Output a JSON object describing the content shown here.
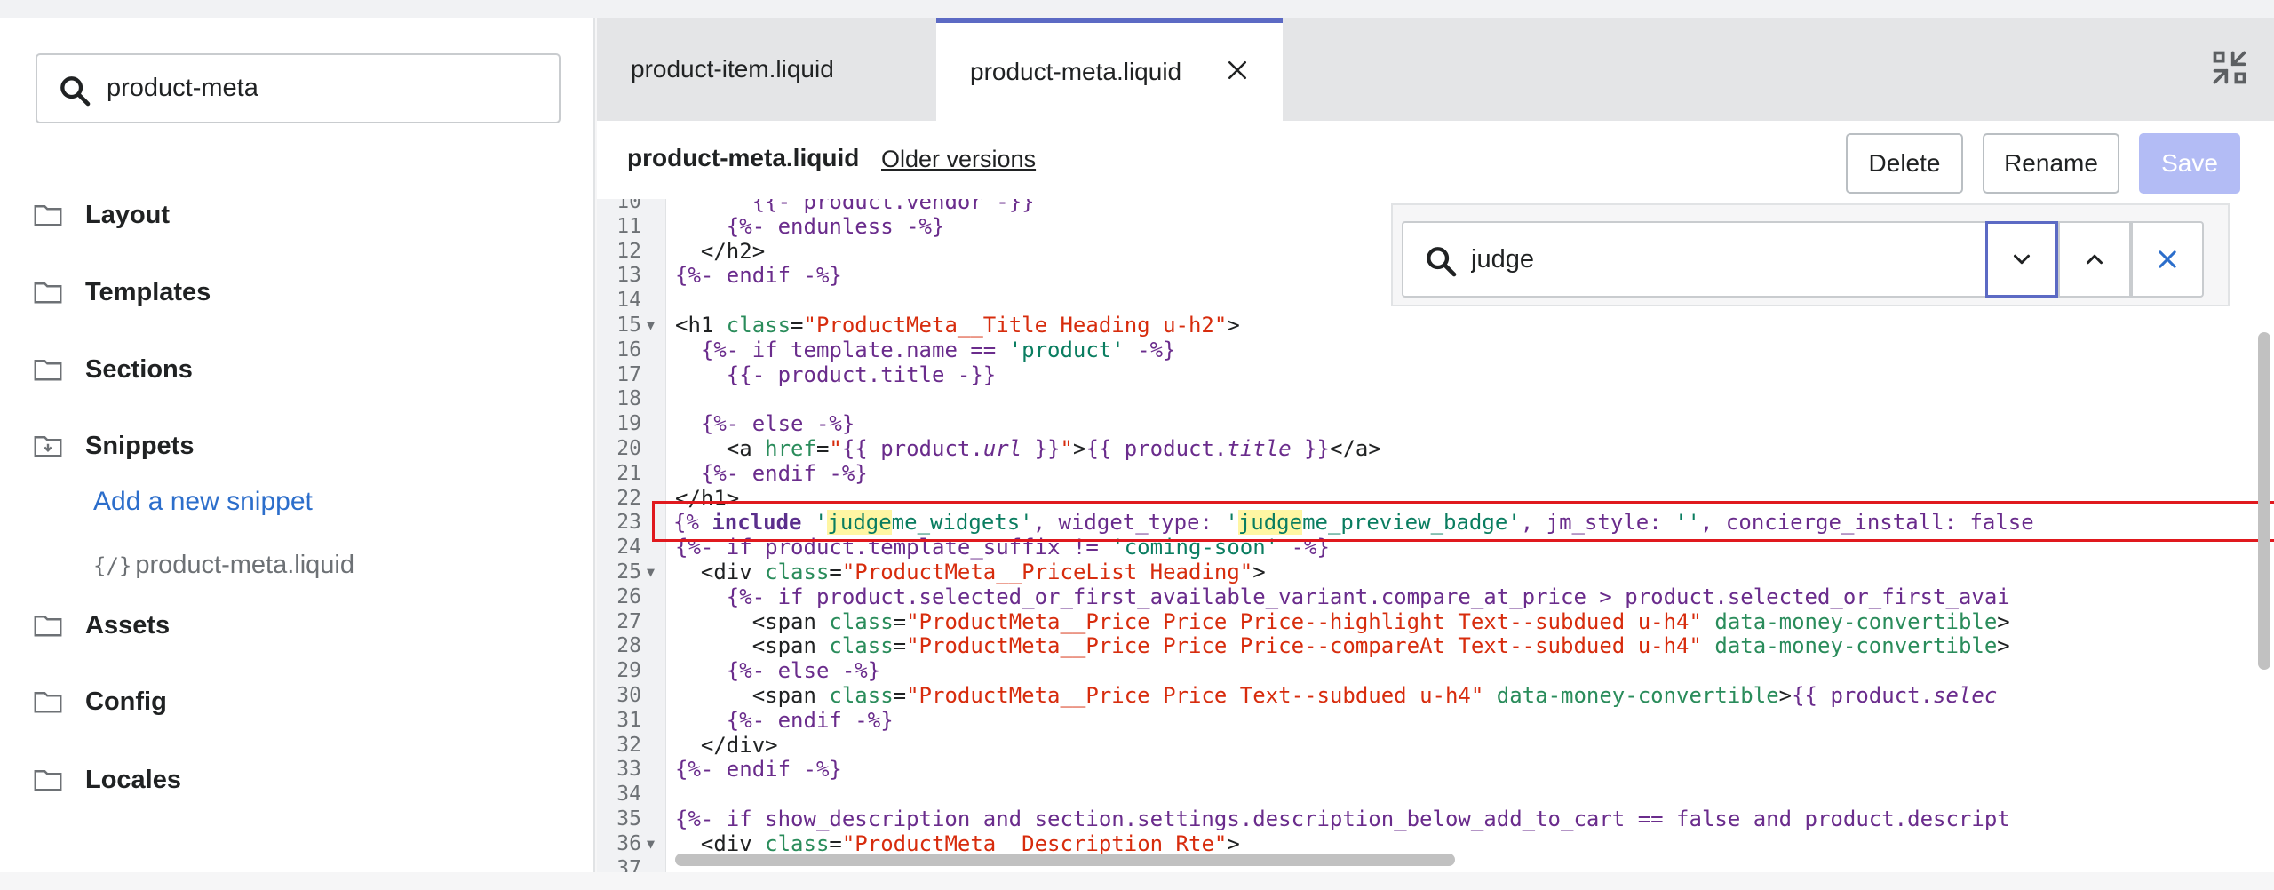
{
  "sidebar": {
    "search": {
      "value": "product-meta",
      "placeholder": ""
    },
    "folders": [
      {
        "label": "Layout"
      },
      {
        "label": "Templates"
      },
      {
        "label": "Sections"
      },
      {
        "label": "Snippets"
      },
      {
        "label": "Assets"
      },
      {
        "label": "Config"
      },
      {
        "label": "Locales"
      }
    ],
    "snippets": {
      "add_link": "Add a new snippet",
      "file": "product-meta.liquid",
      "file_icon": "{/}"
    }
  },
  "tabs": [
    {
      "label": "product-item.liquid"
    },
    {
      "label": "product-meta.liquid"
    }
  ],
  "editor_header": {
    "file_title": "product-meta.liquid",
    "older_versions": "Older versions",
    "delete_label": "Delete",
    "rename_label": "Rename",
    "save_label": "Save"
  },
  "find": {
    "value": "judge"
  },
  "line_numbers": [
    "10",
    "11",
    "12",
    "13",
    "14",
    "15",
    "16",
    "17",
    "18",
    "19",
    "20",
    "21",
    "22",
    "23",
    "24",
    "25",
    "26",
    "27",
    "28",
    "29",
    "30",
    "31",
    "32",
    "33",
    "34",
    "35",
    "36",
    "37"
  ],
  "colors": {
    "accent": "#5c6ac4",
    "link": "#2c6ecb",
    "highlight_box": "#e0191e",
    "match": "#fff6a3"
  }
}
